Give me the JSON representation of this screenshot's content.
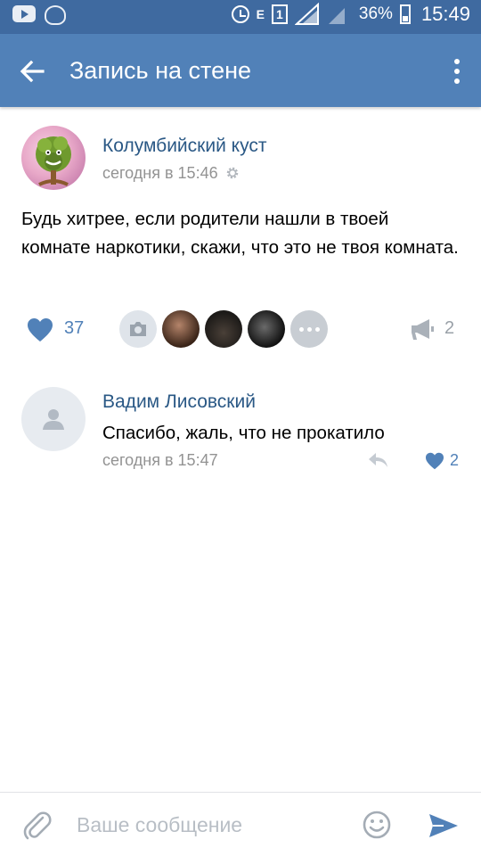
{
  "status_bar": {
    "battery": "36%",
    "time": "15:49",
    "sim": "1",
    "network": "E"
  },
  "header": {
    "title": "Запись на стене"
  },
  "post": {
    "author": "Колумбийский куст",
    "time": "сегодня в 15:46",
    "text": "Будь хитрее, если родители нашли в твоей комнате наркотики, скажи, что это не твоя комната.",
    "likes": "37",
    "shares": "2"
  },
  "comment": {
    "author": "Вадим Лисовский",
    "text": "Спасибо, жаль, что не прокатило",
    "time": "сегодня в 15:47",
    "likes": "2"
  },
  "composer": {
    "placeholder": "Ваше сообщение"
  },
  "colors": {
    "status_bar": "#3f6aa0",
    "header": "#5181b8",
    "link": "#2a5885",
    "accent": "#5181b8",
    "muted": "#939393"
  },
  "icons": [
    "youtube-icon",
    "vk-icon",
    "alarm-icon",
    "signal-icon",
    "battery-icon",
    "back-arrow-icon",
    "more-vertical-icon",
    "gear-icon",
    "heart-icon",
    "camera-icon",
    "more-horizontal-icon",
    "megaphone-icon",
    "user-icon",
    "reply-icon",
    "paperclip-icon",
    "smile-icon",
    "send-icon"
  ]
}
